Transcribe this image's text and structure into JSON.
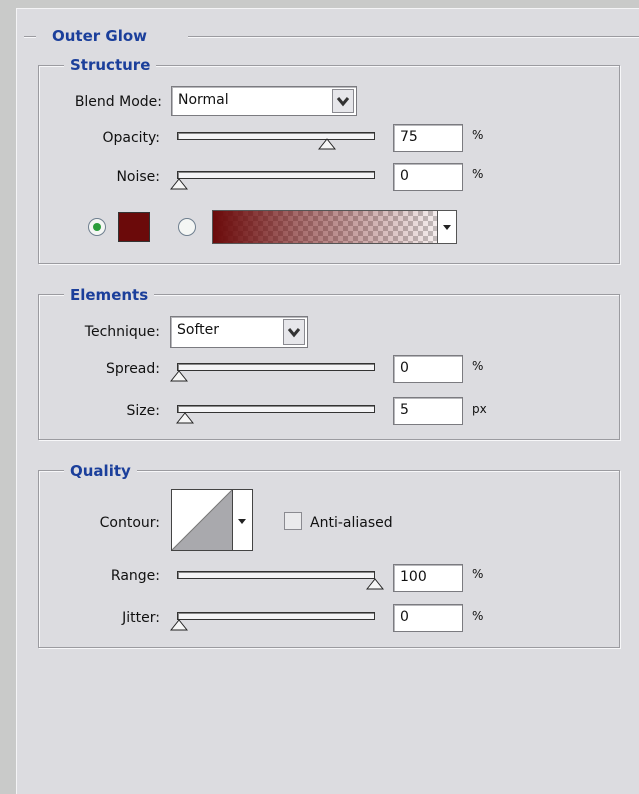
{
  "outer_glow": {
    "title": "Outer Glow",
    "structure": {
      "title": "Structure",
      "blend_mode": {
        "label": "Blend Mode:",
        "value": "Normal"
      },
      "opacity": {
        "label": "Opacity:",
        "value": "75",
        "unit": "%",
        "level": 0.75
      },
      "noise": {
        "label": "Noise:",
        "value": "0",
        "unit": "%",
        "level": 0.0
      },
      "glow_color": "#6b0a0a",
      "color_mode": "solid"
    },
    "elements": {
      "title": "Elements",
      "technique": {
        "label": "Technique:",
        "value": "Softer"
      },
      "spread": {
        "label": "Spread:",
        "value": "0",
        "unit": "%",
        "level": 0.0
      },
      "size": {
        "label": "Size:",
        "value": "5",
        "unit": "px",
        "level": 0.03
      }
    },
    "quality": {
      "title": "Quality",
      "contour": {
        "label": "Contour:"
      },
      "anti_aliased": {
        "label": "Anti-aliased",
        "checked": false
      },
      "range": {
        "label": "Range:",
        "value": "100",
        "unit": "%",
        "level": 1.0
      },
      "jitter": {
        "label": "Jitter:",
        "value": "0",
        "unit": "%",
        "level": 0.0
      }
    }
  },
  "colors": {
    "accent": "#1b3f9b",
    "panel_bg": "#dcdce0",
    "radio_selected": "#2a9d3a"
  },
  "icons": {
    "dropdown": "chevron-down-icon",
    "slider_thumb": "triangle-thumb-icon"
  }
}
